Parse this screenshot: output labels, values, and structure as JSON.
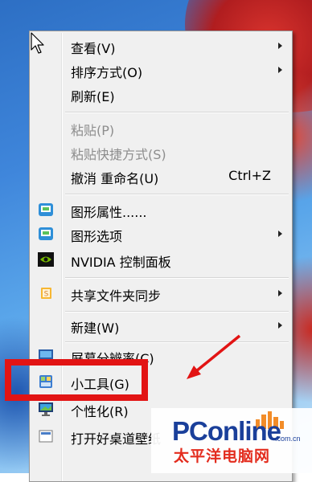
{
  "menu": {
    "items": [
      {
        "label": "查看(V)",
        "submenu": true
      },
      {
        "label": "排序方式(O)",
        "submenu": true
      },
      {
        "label": "刷新(E)"
      },
      {
        "label": "粘贴(P)",
        "disabled": true
      },
      {
        "label": "粘贴快捷方式(S)",
        "disabled": true
      },
      {
        "label": "撤消 重命名(U)",
        "shortcut": "Ctrl+Z"
      },
      {
        "label": "图形属性......",
        "icon": "intel-graphics-icon"
      },
      {
        "label": "图形选项",
        "icon": "intel-graphics-icon",
        "submenu": true
      },
      {
        "label": "NVIDIA 控制面板",
        "icon": "nvidia-icon"
      },
      {
        "label": "共享文件夹同步",
        "icon": "sync-folder-icon",
        "submenu": true
      },
      {
        "label": "新建(W)",
        "submenu": true
      },
      {
        "label": "屏幕分辨率(C)",
        "icon": "display-icon"
      },
      {
        "label": "小工具(G)",
        "icon": "gadgets-icon"
      },
      {
        "label": "个性化(R)",
        "icon": "personalize-icon"
      },
      {
        "label": "打开好桌道壁纸",
        "icon": "wallpaper-icon"
      }
    ]
  },
  "annotation": {
    "highlight_color": "#e21414",
    "target": "个性化(R)"
  },
  "watermark": {
    "brand": "PConline",
    "domain_suffix": ".com.cn",
    "chinese": "太平洋电脑网"
  },
  "colors": {
    "menu_bg": "#f0f0f0",
    "disabled_text": "#8d8d8d",
    "desktop_blue": "#3f86db"
  }
}
